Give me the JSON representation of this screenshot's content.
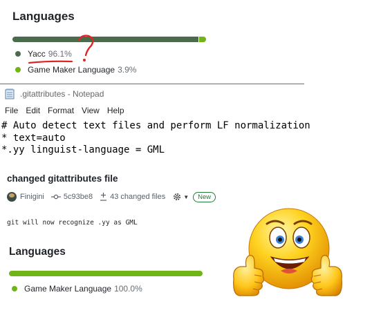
{
  "languages_top": {
    "title": "Languages",
    "items": [
      {
        "name": "Yacc",
        "percent": "96.1%",
        "value": 96.1,
        "color": "#4b6c4c"
      },
      {
        "name": "Game Maker Language",
        "percent": "3.9%",
        "value": 3.9,
        "color": "#71b417"
      }
    ]
  },
  "annotation": {
    "mark": "?",
    "color": "#e02424"
  },
  "notepad": {
    "title": ".gitattributes - Notepad",
    "menu": [
      "File",
      "Edit",
      "Format",
      "View",
      "Help"
    ],
    "lines": [
      "# Auto detect text files and perform LF normalization",
      "* text=auto",
      "*.yy linguist-language = GML"
    ]
  },
  "commit": {
    "title": "changed gitattributes file",
    "author": "Finigini",
    "sha": "5c93be8",
    "changed_files": "43 changed files",
    "badge": "New",
    "message": "git will now recognize .yy as GML",
    "icons": [
      "avatar",
      "git-commit-icon",
      "diff-plus-minus-icon",
      "gear-icon",
      "caret-down-icon"
    ]
  },
  "languages_bottom": {
    "title": "Languages",
    "items": [
      {
        "name": "Game Maker Language",
        "percent": "100.0%",
        "value": 100.0,
        "color": "#71b417"
      }
    ]
  },
  "emoji": {
    "name": "thumbs-up-smiley-icon"
  }
}
